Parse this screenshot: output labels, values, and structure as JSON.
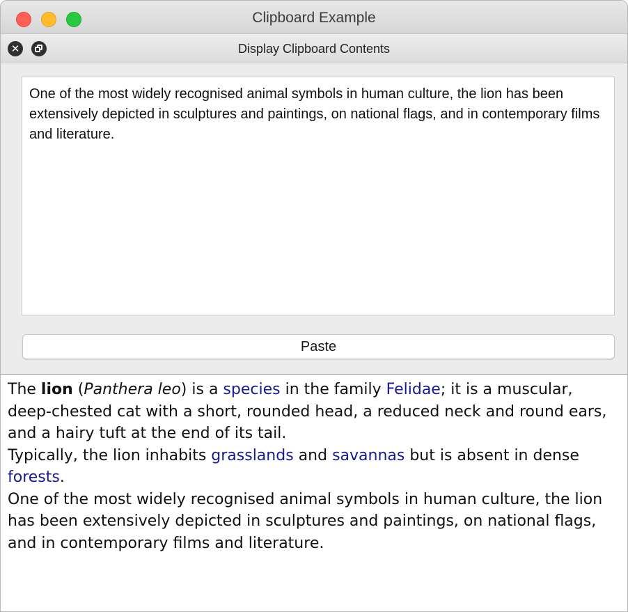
{
  "window": {
    "title": "Clipboard Example"
  },
  "dock": {
    "title": "Display Clipboard Contents",
    "clipboard_text": "One of the most widely recognised animal symbols in human culture, the lion has been extensively depicted in sculptures and paintings, on national flags, and in contemporary films and literature.",
    "paste_label": "Paste"
  },
  "browser": {
    "p1": {
      "t1": "The ",
      "bold": "lion",
      "t2": " (",
      "italic": "Panthera leo",
      "t3": ") is a ",
      "link1": "species",
      "t4": " in the family ",
      "link2": "Felidae",
      "t5": "; it is a muscular, deep-chested cat with a short, rounded head, a reduced neck and round ears, and a hairy tuft at the end of its tail."
    },
    "p2": {
      "t1": "Typically, the lion inhabits ",
      "link1": "grasslands",
      "t2": " and ",
      "link2": "savannas",
      "t3": " but is absent in dense ",
      "link3": "forests",
      "t4": "."
    },
    "p3": "One of the most widely recognised animal symbols in human culture, the lion has been extensively depicted in sculptures and paintings, on national flags, and in contemporary films and literature."
  },
  "colors": {
    "link": "#1a1a8c",
    "close_light": "#ff5f57",
    "minimize_light": "#febc2e",
    "maximize_light": "#28c840"
  }
}
